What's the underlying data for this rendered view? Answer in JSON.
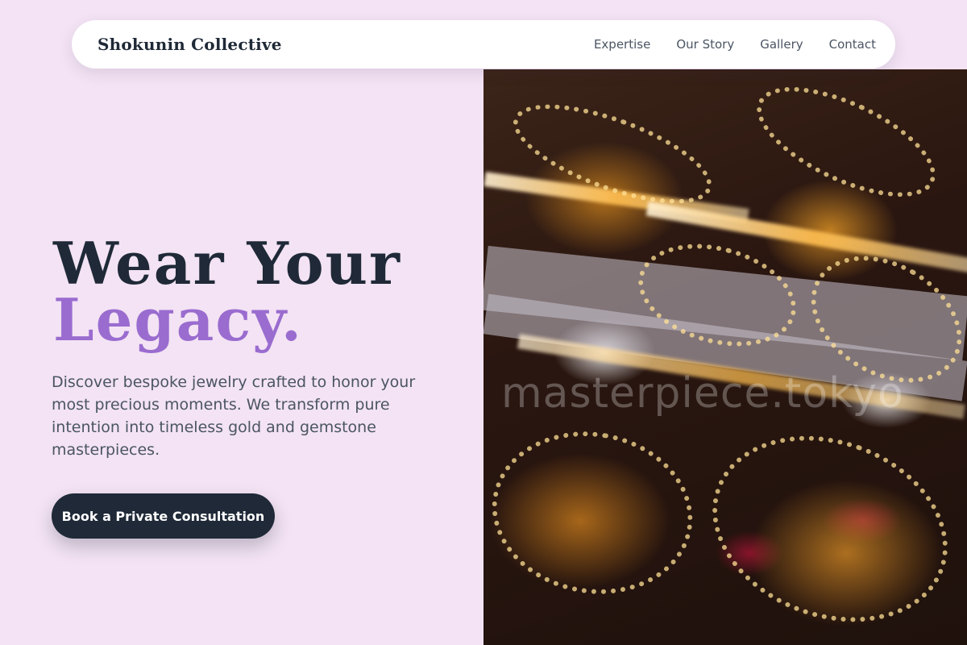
{
  "nav": {
    "brand": "Shokunin Collective",
    "links": [
      "Expertise",
      "Our Story",
      "Gallery",
      "Contact"
    ]
  },
  "hero": {
    "headline_line1": "Wear Your",
    "headline_line2": "Legacy.",
    "subtext": "Discover bespoke jewelry crafted to honor your most precious moments. We transform pure intention into timeless gold and gemstone masterpieces.",
    "cta_label": "Book a Private Consultation",
    "image_watermark": "masterpiece.tokyo"
  },
  "colors": {
    "page_background": "#f3e3f4",
    "text_dark": "#1f2937",
    "accent_purple": "#9a6ccf",
    "body_text": "#4b5563",
    "button_background": "#1f2937"
  }
}
